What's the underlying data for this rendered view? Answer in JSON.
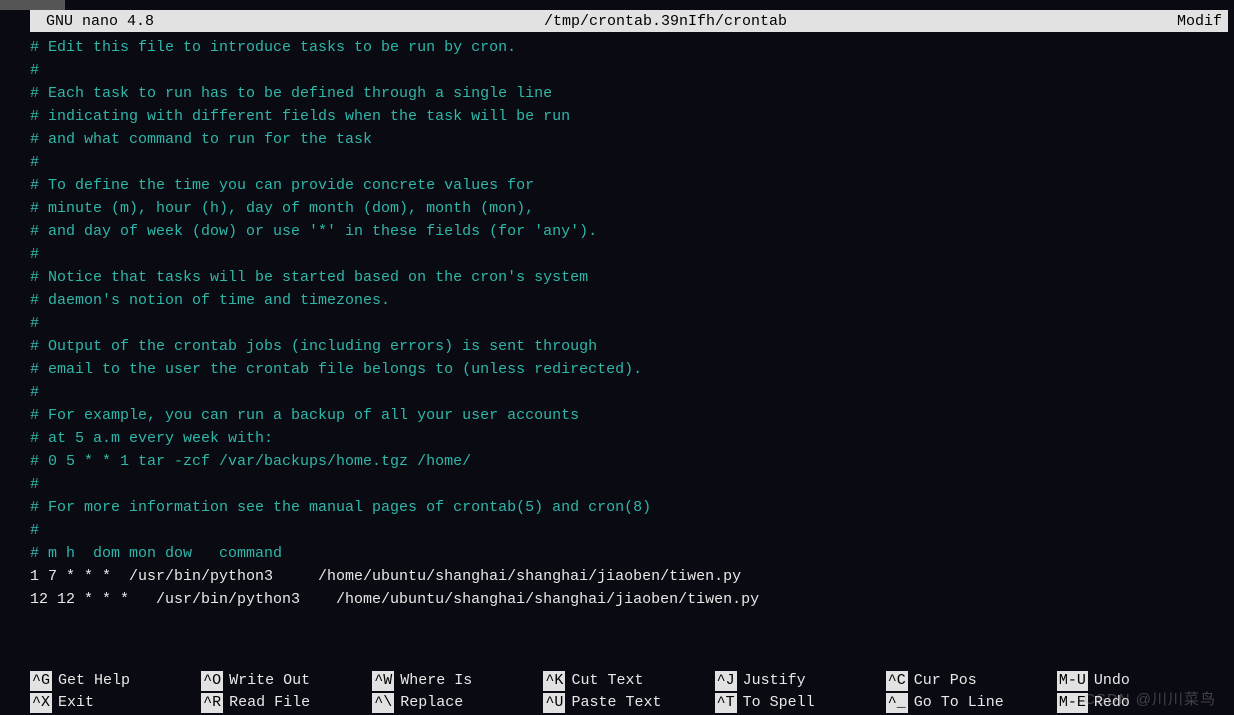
{
  "titlebar": {
    "app": "GNU nano 4.8",
    "path": "/tmp/crontab.39nIfh/crontab",
    "status": "Modif"
  },
  "lines": [
    {
      "cls": "comment",
      "text": "# Edit this file to introduce tasks to be run by cron."
    },
    {
      "cls": "comment",
      "text": "#"
    },
    {
      "cls": "comment",
      "text": "# Each task to run has to be defined through a single line"
    },
    {
      "cls": "comment",
      "text": "# indicating with different fields when the task will be run"
    },
    {
      "cls": "comment",
      "text": "# and what command to run for the task"
    },
    {
      "cls": "comment",
      "text": "#"
    },
    {
      "cls": "comment",
      "text": "# To define the time you can provide concrete values for"
    },
    {
      "cls": "comment",
      "text": "# minute (m), hour (h), day of month (dom), month (mon),"
    },
    {
      "cls": "comment",
      "text": "# and day of week (dow) or use '*' in these fields (for 'any')."
    },
    {
      "cls": "comment",
      "text": "#"
    },
    {
      "cls": "comment",
      "text": "# Notice that tasks will be started based on the cron's system"
    },
    {
      "cls": "comment",
      "text": "# daemon's notion of time and timezones."
    },
    {
      "cls": "comment",
      "text": "#"
    },
    {
      "cls": "comment",
      "text": "# Output of the crontab jobs (including errors) is sent through"
    },
    {
      "cls": "comment",
      "text": "# email to the user the crontab file belongs to (unless redirected)."
    },
    {
      "cls": "comment",
      "text": "#"
    },
    {
      "cls": "comment",
      "text": "# For example, you can run a backup of all your user accounts"
    },
    {
      "cls": "comment",
      "text": "# at 5 a.m every week with:"
    },
    {
      "cls": "comment",
      "text": "# 0 5 * * 1 tar -zcf /var/backups/home.tgz /home/"
    },
    {
      "cls": "comment",
      "text": "#"
    },
    {
      "cls": "comment",
      "text": "# For more information see the manual pages of crontab(5) and cron(8)"
    },
    {
      "cls": "comment",
      "text": "#"
    },
    {
      "cls": "comment",
      "text": "# m h  dom mon dow   command"
    },
    {
      "cls": "plain",
      "text": "1 7 * * *  /usr/bin/python3     /home/ubuntu/shanghai/shanghai/jiaoben/tiwen.py"
    },
    {
      "cls": "plain",
      "text": "12 12 * * *   /usr/bin/python3    /home/ubuntu/shanghai/shanghai/jiaoben/tiwen.py"
    }
  ],
  "shortcuts": [
    {
      "key": "^G",
      "label": "Get Help"
    },
    {
      "key": "^O",
      "label": "Write Out"
    },
    {
      "key": "^W",
      "label": "Where Is"
    },
    {
      "key": "^K",
      "label": "Cut Text"
    },
    {
      "key": "^J",
      "label": "Justify"
    },
    {
      "key": "^C",
      "label": "Cur Pos"
    },
    {
      "key": "M-U",
      "label": "Undo"
    },
    {
      "key": "^X",
      "label": "Exit"
    },
    {
      "key": "^R",
      "label": "Read File"
    },
    {
      "key": "^\\",
      "label": "Replace"
    },
    {
      "key": "^U",
      "label": "Paste Text"
    },
    {
      "key": "^T",
      "label": "To Spell"
    },
    {
      "key": "^_",
      "label": "Go To Line"
    },
    {
      "key": "M-E",
      "label": "Redo"
    }
  ],
  "watermark": "CSDN @川川菜鸟"
}
